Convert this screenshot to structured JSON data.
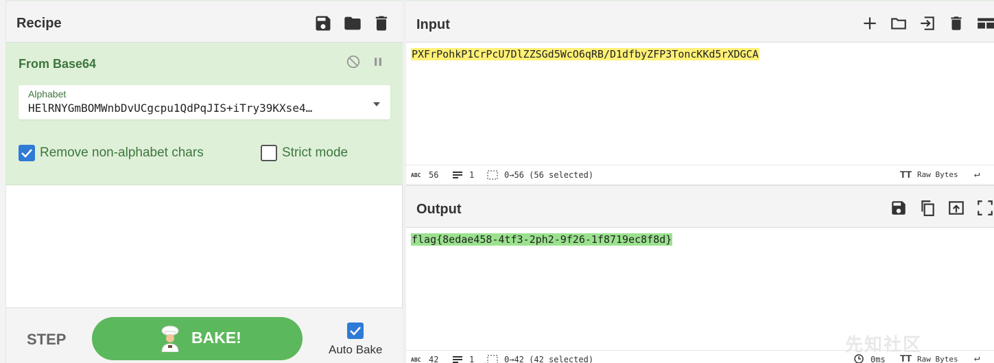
{
  "recipe": {
    "title": "Recipe",
    "operation": {
      "name": "From Base64",
      "alphabet_label": "Alphabet",
      "alphabet_value": "HElRNYGmBOMWnbDvUCgcpu1QdPqJIS+iTry39KXse4…",
      "remove_nonalpha_label": "Remove non-alphabet chars",
      "remove_nonalpha_checked": true,
      "strict_mode_label": "Strict mode",
      "strict_mode_checked": false
    },
    "footer": {
      "step_label": "STEP",
      "bake_label": "BAKE!",
      "autobake_label": "Auto Bake",
      "autobake_checked": true
    }
  },
  "input": {
    "title": "Input",
    "text": "PXFrPohkP1CrPcU7DlZZSGd5WcO6qRB/D1dfbyZFP3ToncKKd5rXDGCA",
    "status": {
      "chars": "56",
      "lines": "1",
      "selection": "0→56 (56 selected)",
      "encoding": "Raw Bytes"
    }
  },
  "output": {
    "title": "Output",
    "text": "flag{8edae458-4tf3-2ph2-9f26-1f8719ec8f8d}",
    "status": {
      "chars": "42",
      "lines": "1",
      "selection": "0→42 (42 selected)",
      "time": "0ms",
      "encoding": "Raw Bytes"
    }
  },
  "watermark": "先知社区",
  "colors": {
    "operation_bg": "#dff0d8",
    "operation_text": "#3c763d",
    "bake_green": "#5cb85c",
    "checkbox_blue": "#2f7bd6",
    "input_highlight": "#fff176",
    "output_highlight": "#9be28f"
  }
}
